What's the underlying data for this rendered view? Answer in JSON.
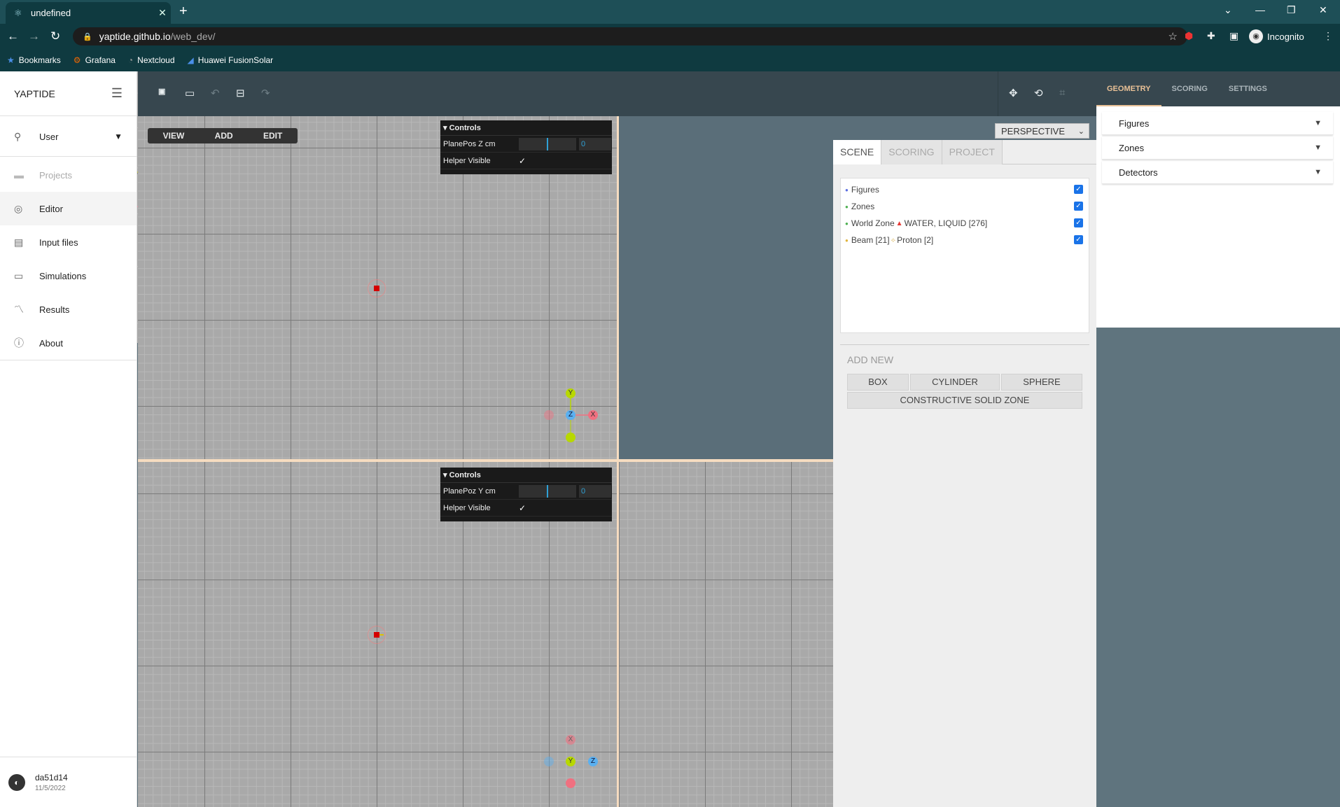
{
  "browser": {
    "tab_title": "undefined",
    "url_host": "yaptide.github.io",
    "url_path": "/web_dev/",
    "profile": "Incognito",
    "bookmarks": [
      "Bookmarks",
      "Grafana",
      "Nextcloud",
      "Huawei FusionSolar"
    ]
  },
  "app": {
    "logo": "YAPTIDE",
    "nav": {
      "user": "User",
      "projects": "Projects",
      "editor": "Editor",
      "input_files": "Input files",
      "simulations": "Simulations",
      "results": "Results",
      "about": "About"
    },
    "footer": {
      "version": "da51d14",
      "date": "11/5/2022"
    }
  },
  "toolbar": {
    "new_icon": "new-file-icon",
    "open_icon": "folder-icon",
    "undo_icon": "undo-icon",
    "save_icon": "save-icon",
    "redo_icon": "redo-icon",
    "right_icons": [
      "move-arrows-icon",
      "rotate-icon",
      "crop-icon"
    ]
  },
  "editor": {
    "menu": [
      "VIEW",
      "ADD",
      "EDIT"
    ],
    "controls_top": {
      "title": "Controls",
      "plane_label": "PlanePos Z cm",
      "plane_value": "0",
      "helper_label": "Helper Visible",
      "helper_checked": "✓"
    },
    "controls_bottom": {
      "title": "Controls",
      "plane_label": "PlanePoz Y cm",
      "plane_value": "0",
      "helper_label": "Helper Visible",
      "helper_checked": "✓"
    },
    "camera": "PERSPECTIVE",
    "gizmo_top": {
      "y": "Y",
      "z": "Z",
      "x": "X"
    },
    "gizmo_bottom": {
      "x": "X",
      "y": "Y",
      "z": "Z"
    }
  },
  "scene_panel": {
    "tabs": [
      "SCENE",
      "SCORING",
      "PROJECT"
    ],
    "outliner": [
      {
        "label": "Figures",
        "dot_color": "#5b6ee1"
      },
      {
        "label": "Zones",
        "dot_color": "#4caf50"
      },
      {
        "label": "World Zone",
        "extra": "WATER, LIQUID [276]",
        "dot_color": "#4caf50"
      },
      {
        "label": "Beam [21]",
        "extra": "Proton [2]",
        "dot_color": "#e0b43c"
      }
    ],
    "add_new": "ADD NEW",
    "buttons": {
      "box": "BOX",
      "cylinder": "CYLINDER",
      "sphere": "SPHERE",
      "csz": "CONSTRUCTIVE SOLID ZONE"
    }
  },
  "right_panel": {
    "tabs": [
      "GEOMETRY",
      "SCORING",
      "SETTINGS"
    ],
    "sections": [
      "Figures",
      "Zones",
      "Detectors"
    ]
  },
  "colors": {
    "accent": "#e8c096",
    "toolbar": "#37474f",
    "checkbox": "#1a73e8"
  }
}
